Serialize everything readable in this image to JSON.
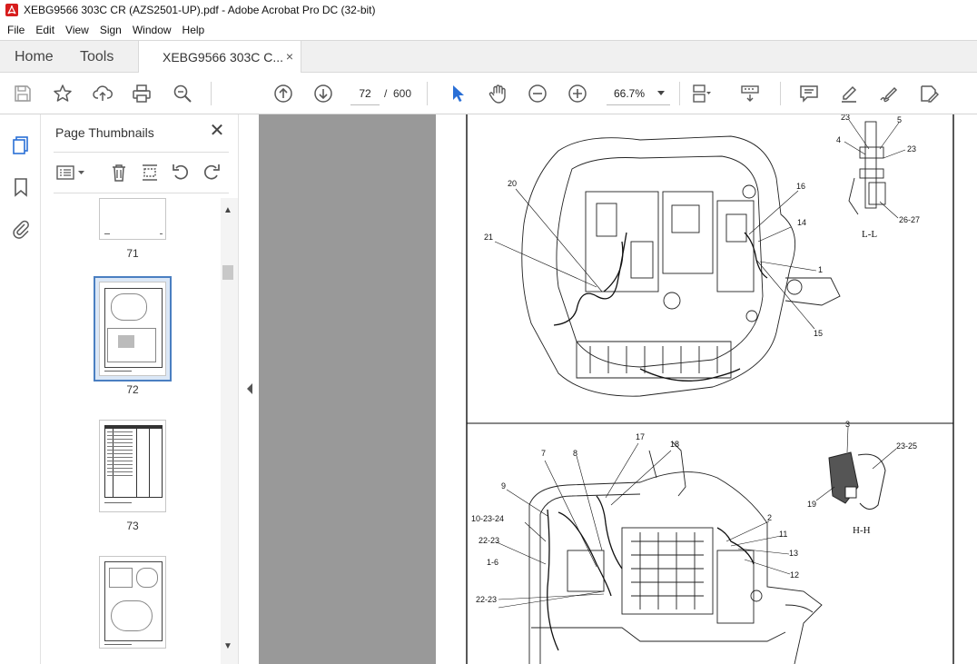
{
  "window": {
    "title": "XEBG9566 303C CR (AZS2501-UP).pdf - Adobe Acrobat Pro DC (32-bit)",
    "app_icon": "acrobat-icon"
  },
  "menu": [
    "File",
    "Edit",
    "View",
    "Sign",
    "Window",
    "Help"
  ],
  "tabs": {
    "home": "Home",
    "tools": "Tools",
    "document": "XEBG9566 303C C...",
    "close_glyph": "×"
  },
  "toolbar": {
    "icons": [
      "save-icon",
      "bookmark-star-icon",
      "upload-icon",
      "print-icon",
      "zoom-search-icon",
      "previous-page-icon",
      "next-page-icon",
      "select-cursor-icon",
      "hand-icon",
      "zoom-out-icon",
      "zoom-in-icon",
      "page-fit-icon",
      "scroll-mode-icon",
      "comment-icon",
      "highlight-icon",
      "sign-icon",
      "fill-sign-icon"
    ],
    "page_current": "72",
    "page_separator": "/",
    "page_total": "600",
    "zoom": "66.7%"
  },
  "left_rail": {
    "icons": [
      "page-thumbnails-icon",
      "bookmarks-icon",
      "attachments-icon"
    ]
  },
  "thumbnails": {
    "title": "Page Thumbnails",
    "close_glyph": "✕",
    "tools": [
      "options-menu-icon",
      "delete-icon",
      "insert-pages-icon",
      "rotate-left-icon",
      "rotate-right-icon"
    ],
    "pages": [
      {
        "label": "71"
      },
      {
        "label": "72",
        "selected": true
      },
      {
        "label": "73"
      },
      {
        "label": ""
      }
    ]
  },
  "document": {
    "upper_view": {
      "callouts": [
        "20",
        "21",
        "16",
        "14",
        "1",
        "15",
        "23"
      ]
    },
    "section_ll": {
      "callouts": [
        "5",
        "4",
        "23",
        "26-27"
      ],
      "caption": "L-L"
    },
    "section_hh": {
      "callouts": [
        "3",
        "23-25",
        "19"
      ],
      "caption": "H-H"
    },
    "lower_view": {
      "callouts": [
        "17",
        "18",
        "7",
        "8",
        "9",
        "10-23-24",
        "22-23",
        "1-6",
        "22-23",
        "2",
        "11",
        "13",
        "12"
      ]
    }
  },
  "colors": {
    "accent": "#2a6fd6",
    "icon": "#5a5a5a",
    "canvas": "#999999",
    "selected_thumb_border": "#4a7fc1",
    "selected_thumb_fill": "#dbe7f6"
  }
}
